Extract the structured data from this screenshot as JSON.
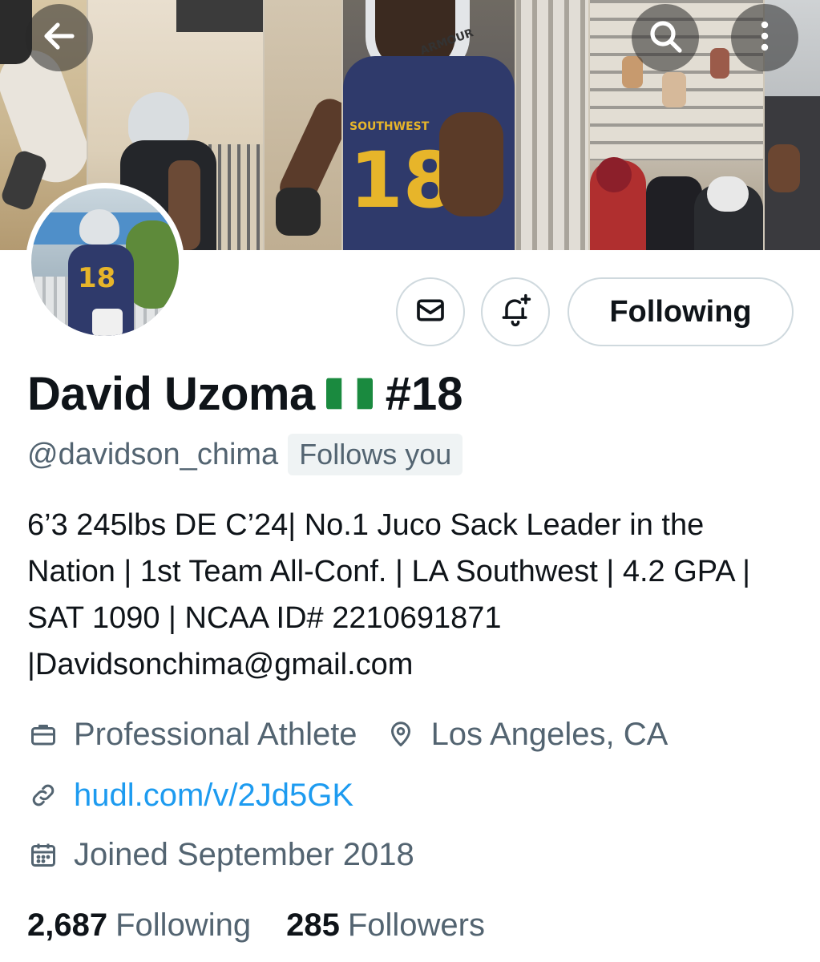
{
  "banner": {
    "description_icons": {
      "back": "arrow-left-icon",
      "search": "search-icon",
      "more": "more-vertical-icon"
    },
    "jersey_number": "18",
    "helmet_text": "ARMOUR",
    "jersey_text": "SOUTHWEST"
  },
  "actions": {
    "message_icon": "envelope-icon",
    "notify_icon": "bell-plus-icon",
    "follow_label": "Following"
  },
  "profile": {
    "name": "David Uzoma",
    "flag": "nigeria-flag",
    "number": "#18",
    "handle": "@davidson_chima",
    "follows_you": "Follows you",
    "bio": "6’3 245lbs DE C’24| No.1 Juco Sack Leader in the Nation | 1st Team All-Conf. | LA Southwest | 4.2 GPA | SAT 1090 | NCAA ID# 2210691871 |Davidsonchima@gmail.com",
    "profession": "Professional Athlete",
    "location": "Los Angeles, CA",
    "website": "hudl.com/v/2Jd5GK",
    "joined": "Joined September 2018"
  },
  "stats": {
    "following_count": "2,687",
    "following_label": "Following",
    "followers_count": "285",
    "followers_label": "Followers"
  },
  "colors": {
    "accent_link": "#1d9bf0",
    "secondary_text": "#536471",
    "primary_text": "#0f1419",
    "border": "#cfd9de",
    "jersey_navy": "#2f3a6b",
    "jersey_gold": "#e7b52a"
  }
}
